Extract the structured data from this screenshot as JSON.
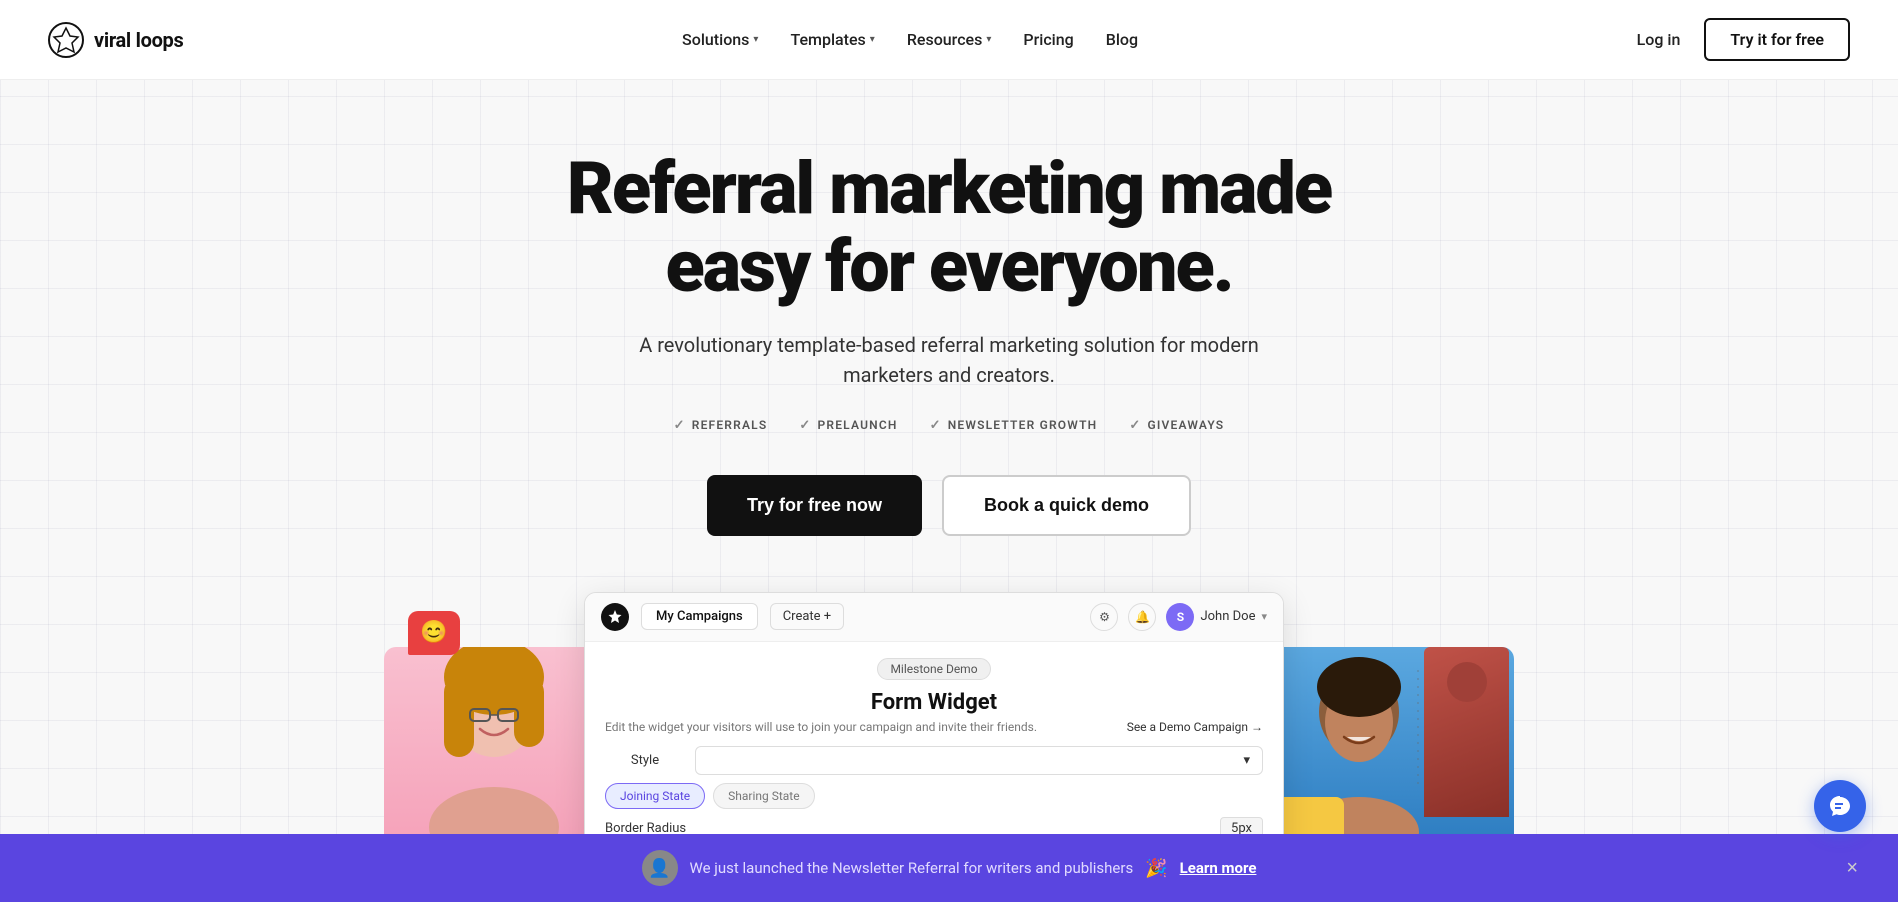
{
  "brand": {
    "name": "viral loops",
    "logo_alt": "Viral Loops logo"
  },
  "nav": {
    "links": [
      {
        "label": "Solutions",
        "has_dropdown": true
      },
      {
        "label": "Templates",
        "has_dropdown": true
      },
      {
        "label": "Resources",
        "has_dropdown": true
      },
      {
        "label": "Pricing",
        "has_dropdown": false
      },
      {
        "label": "Blog",
        "has_dropdown": false
      }
    ],
    "login_label": "Log in",
    "cta_label": "Try it for free"
  },
  "hero": {
    "title": "Referral marketing made easy for everyone.",
    "subtitle": "A revolutionary template-based referral marketing solution for modern marketers and creators.",
    "features": [
      "REFERRALS",
      "PRELAUNCH",
      "NEWSLETTER GROWTH",
      "GIVEAWAYS"
    ],
    "btn_primary": "Try for free now",
    "btn_secondary": "Book a quick demo"
  },
  "dashboard": {
    "tab_my_campaigns": "My Campaigns",
    "tab_create": "Create +",
    "user_initial": "S",
    "user_name": "John Doe",
    "badge_label": "Milestone Demo",
    "form_title": "Form Widget",
    "form_desc": "Edit the widget your visitors will use to join your campaign and invite their friends.",
    "see_demo": "See a Demo Campaign →",
    "style_label": "Style",
    "style_value": "",
    "joining_state": "Joining State",
    "sharing_state": "Sharing State",
    "border_radius_label": "Border Radius",
    "border_radius_value": "5px"
  },
  "notification": {
    "text": "We just launched the Newsletter Referral for writers and publishers",
    "emoji": "🎉",
    "learn_more": "Learn more",
    "close_label": "×"
  },
  "chat_widget": {
    "label": "chat-widget"
  }
}
